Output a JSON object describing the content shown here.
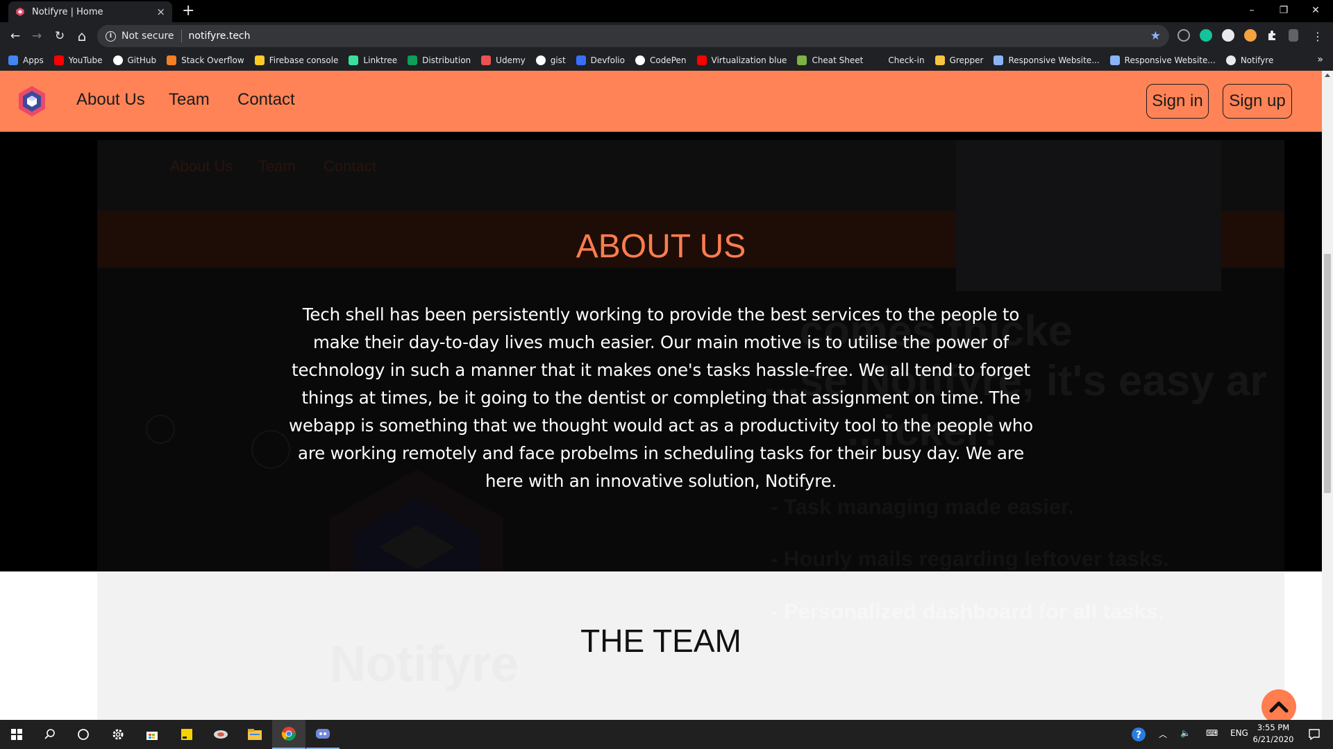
{
  "browser": {
    "tab_title": "Notifyre | Home",
    "tab_close": "×",
    "new_tab": "+",
    "security_label": "Not secure",
    "url": "notifyre.tech",
    "window_controls": {
      "minimize": "–",
      "restore": "❐",
      "close": "✕"
    },
    "nav_icons": {
      "back": "←",
      "forward": "→",
      "reload": "↻",
      "home": "⌂"
    },
    "bookmark_star": "★",
    "bookmarks_more": "»",
    "bookmarks": [
      {
        "label": "Apps",
        "icon": "apps-grid-icon",
        "color": "#4285f4"
      },
      {
        "label": "YouTube",
        "icon": "youtube-icon",
        "color": "#ff0000"
      },
      {
        "label": "GitHub",
        "icon": "github-icon",
        "color": "#ffffff"
      },
      {
        "label": "Stack Overflow",
        "icon": "stackoverflow-icon",
        "color": "#f48024"
      },
      {
        "label": "Firebase console",
        "icon": "firebase-icon",
        "color": "#ffca28"
      },
      {
        "label": "Linktree",
        "icon": "linktree-icon",
        "color": "#39e09b"
      },
      {
        "label": "Distribution",
        "icon": "distribution-icon",
        "color": "#0f9d58"
      },
      {
        "label": "Udemy",
        "icon": "udemy-icon",
        "color": "#ec5252"
      },
      {
        "label": "gist",
        "icon": "github-icon",
        "color": "#ffffff"
      },
      {
        "label": "Devfolio",
        "icon": "devfolio-icon",
        "color": "#3770ff"
      },
      {
        "label": "CodePen",
        "icon": "codepen-icon",
        "color": "#ffffff"
      },
      {
        "label": "Virtualization blue",
        "icon": "youtube-icon",
        "color": "#ff0000"
      },
      {
        "label": "Cheat Sheet",
        "icon": "cheatsheet-icon",
        "color": "#7cb342"
      },
      {
        "label": "Check-in",
        "icon": "checkin-icon",
        "color": "#202124"
      },
      {
        "label": "Grepper",
        "icon": "grepper-icon",
        "color": "#f5c542"
      },
      {
        "label": "Responsive Website...",
        "icon": "play-icon",
        "color": "#8ab4f8"
      },
      {
        "label": "Responsive Website...",
        "icon": "play-icon",
        "color": "#8ab4f8"
      },
      {
        "label": "Notifyre",
        "icon": "globe-icon",
        "color": "#e8eaed"
      }
    ]
  },
  "site": {
    "nav": {
      "links": [
        "About Us",
        "Team",
        "Contact"
      ],
      "sign_in": "Sign in",
      "sign_up": "Sign up"
    },
    "about": {
      "title": "ABOUT US",
      "body": "Tech shell has been persistently working to provide the best services to the people to make their day-to-day lives much easier. Our main motive is to utilise the power of technology in such a manner that it makes one's tasks hassle-free. We all tend to forget things at times, be it going to the dentist or completing that assignment on time. The webapp is something that we thought would act as a productivity tool to the people who are working remotely and face probelms in scheduling tasks for their busy day. We are here with an innovative solution, Notifyre."
    },
    "ghost": {
      "nav_links": [
        "About Us",
        "Team",
        "Contact"
      ],
      "hero_lines": [
        "...comes thicke",
        "...se Notifyre, it's easy ar",
        "...icker!"
      ],
      "features": [
        "- Task managing made easier.",
        "- Hourly mails regarding leftover tasks.",
        "- Personalized dashboard for all tasks."
      ],
      "brand": "Notifyre"
    },
    "team": {
      "title": "THE TEAM"
    },
    "accent_color": "#ff7d4f",
    "nav_color": "#ff8356"
  },
  "taskbar": {
    "lang": "ENG",
    "time": "3:55 PM",
    "date": "6/21/2020"
  }
}
